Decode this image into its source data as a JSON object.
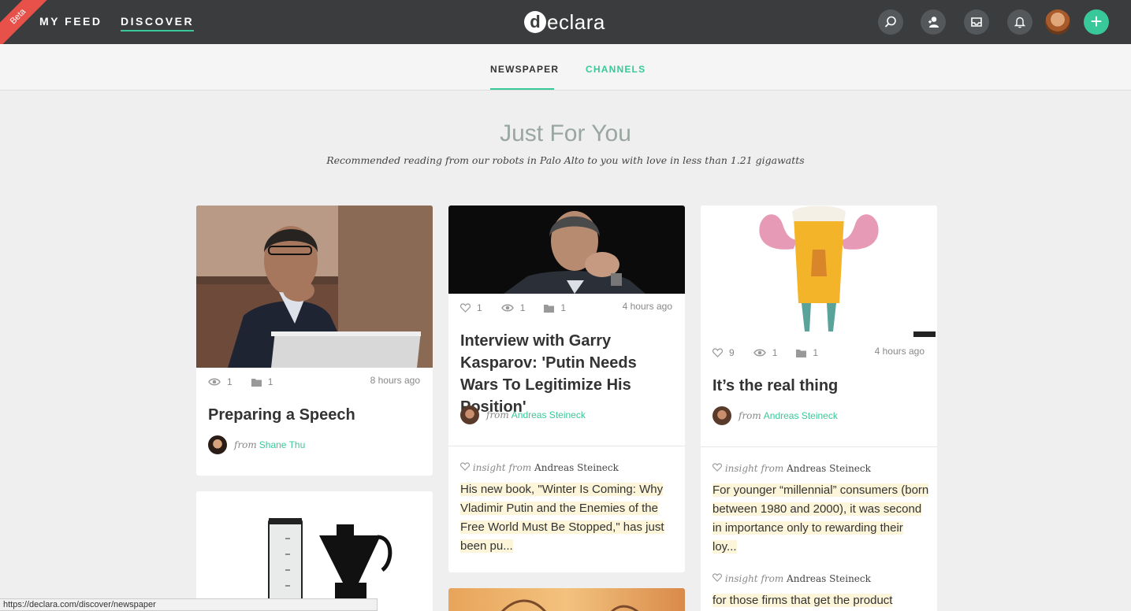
{
  "nav": {
    "beta": "Beta",
    "my_feed": "MY FEED",
    "discover": "DISCOVER",
    "logo_letter": "d",
    "logo_text": "eclara"
  },
  "subnav": {
    "newspaper": "NEWSPAPER",
    "channels": "CHANNELS"
  },
  "hero": {
    "title": "Just For You",
    "subtitle": "Recommended reading from our robots in Palo Alto to you with love in less than 1.21 gigawatts"
  },
  "cards": [
    {
      "views": "1",
      "collections": "1",
      "time": "8 hours ago",
      "title": "Preparing a Speech",
      "from_word": "from",
      "author": "Shane Thu"
    },
    {
      "likes": "1",
      "views": "1",
      "collections": "1",
      "time": "4 hours ago",
      "title": "Interview with Garry Kasparov: 'Putin Needs Wars To Legitimize His Position'",
      "from_word": "from",
      "author": "Andreas Steineck",
      "insight_word": "insight from",
      "insight_author": "Andreas Steineck",
      "quote": "His new book, \"Winter Is Coming: Why Vladimir Putin and the Enemies of the Free World Must Be Stopped,\" has just been pu..."
    },
    {
      "likes": "9",
      "views": "1",
      "collections": "1",
      "time": "4 hours ago",
      "title": "It’s the real thing",
      "from_word": "from",
      "author": "Andreas Steineck",
      "insight_word": "insight from",
      "insight_author": "Andreas Steineck",
      "quote": "For younger “millennial” consumers (born between 1980 and 2000), it was second in importance only to rewarding their loy...",
      "insight2_word": "insight from",
      "insight2_author": "Andreas Steineck",
      "quote2": "for those firms that get the product"
    }
  ],
  "status_url": "https://declara.com/discover/newspaper",
  "colors": {
    "accent": "#39c89a",
    "topbar": "#3a3c3e",
    "beta": "#e8504a",
    "highlight": "#fdf5d9"
  },
  "icons": [
    "search-icon",
    "people-icon",
    "inbox-icon",
    "bell-icon",
    "plus-icon",
    "heart-icon",
    "eye-icon",
    "folder-icon"
  ]
}
